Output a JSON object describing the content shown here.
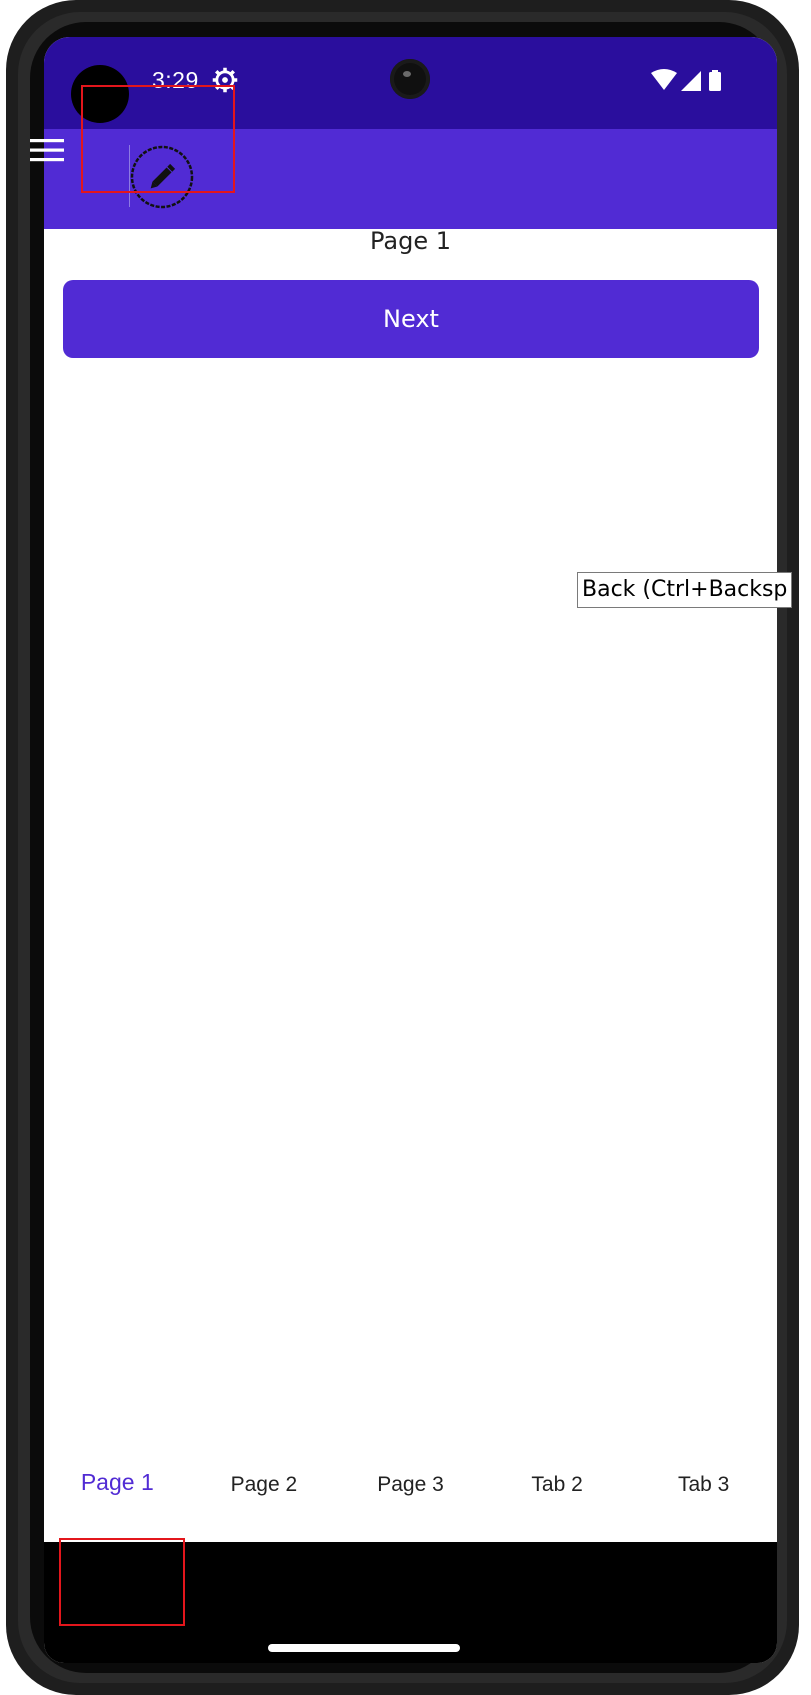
{
  "status_bar": {
    "time": "3:29",
    "icons": [
      "settings-gear-icon",
      "wifi-icon",
      "cell-signal-icon",
      "battery-icon"
    ]
  },
  "app_bar": {
    "menu_icon": "hamburger-menu-icon",
    "action_icon": "edit-pencil-icon"
  },
  "page": {
    "title": "Page 1",
    "next_button": "Next"
  },
  "tooltip": {
    "text": "Back (Ctrl+Backsp"
  },
  "tabs": [
    {
      "label": "Page 1",
      "active": true
    },
    {
      "label": "Page 2",
      "active": false
    },
    {
      "label": "Page 3",
      "active": false
    },
    {
      "label": "Tab 2",
      "active": false
    },
    {
      "label": "Tab 3",
      "active": false
    }
  ],
  "colors": {
    "status_bar": "#2a0e9d",
    "app_bar": "#512bd4",
    "accent": "#512bd4",
    "highlight_box": "#e3161c"
  }
}
